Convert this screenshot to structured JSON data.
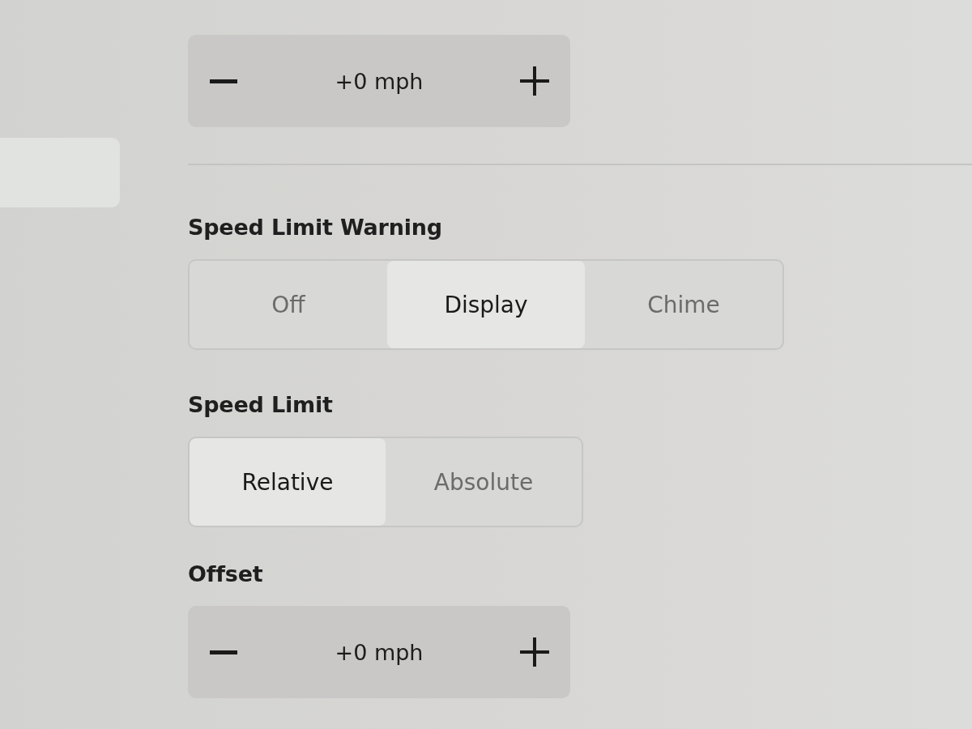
{
  "top_stepper": {
    "value": "+0 mph"
  },
  "speed_limit_warning": {
    "label": "Speed Limit Warning",
    "options": [
      {
        "label": "Off",
        "selected": false
      },
      {
        "label": "Display",
        "selected": true
      },
      {
        "label": "Chime",
        "selected": false
      }
    ]
  },
  "speed_limit": {
    "label": "Speed Limit",
    "options": [
      {
        "label": "Relative",
        "selected": true
      },
      {
        "label": "Absolute",
        "selected": false
      }
    ]
  },
  "offset": {
    "label": "Offset",
    "value": "+0 mph"
  }
}
